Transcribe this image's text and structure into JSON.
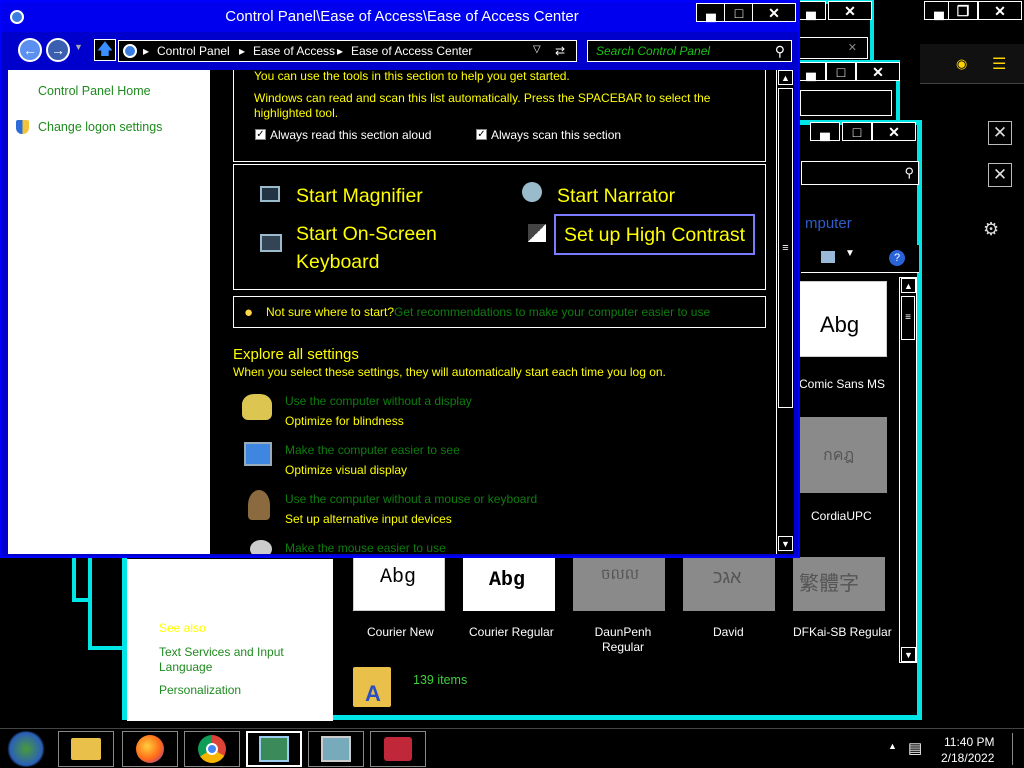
{
  "main_window": {
    "title": "Control Panel\\Ease of Access\\Ease of Access Center",
    "breadcrumbs": [
      "Control Panel",
      "Ease of Access",
      "Ease of Access Center"
    ],
    "search_placeholder": "Search Control Panel"
  },
  "left_pane": {
    "links": [
      "Control Panel Home",
      "Change logon settings"
    ]
  },
  "quick_access": {
    "intro": "You can use the tools in this section to help you get started.",
    "scan_text": "Windows can read and scan this list automatically.  Press the SPACEBAR to select the highlighted tool.",
    "checkbox_read": "Always read this section aloud",
    "checkbox_scan": "Always scan this section",
    "tools": [
      "Start Magnifier",
      "Start Narrator",
      "Start On-Screen Keyboard",
      "Set up High Contrast"
    ]
  },
  "tip": {
    "prefix": "Not sure where to start?",
    "link": "Get recommendations to make your computer easier to use"
  },
  "explore": {
    "heading": "Explore all settings",
    "description": "When you select these settings, they will automatically start each time you log on.",
    "items": [
      {
        "link": "Use the computer without a display",
        "sub": "Optimize for blindness"
      },
      {
        "link": "Make the computer easier to see",
        "sub": "Optimize visual display"
      },
      {
        "link": "Use the computer without a mouse or keyboard",
        "sub": "Set up alternative input devices"
      },
      {
        "link": "Make the mouse easier to use",
        "sub": ""
      }
    ]
  },
  "fonts_window": {
    "title_fragment": "mputer",
    "fonts": [
      {
        "name": "Comic Sans MS",
        "sample": "Abg"
      },
      {
        "name": "CordiaUPC",
        "sample": "กคฎ"
      },
      {
        "name": "Courier New",
        "sample": "Abg"
      },
      {
        "name": "Courier Regular",
        "sample": "Abg"
      },
      {
        "name": "DaunPenh Regular",
        "sample": "ចលល"
      },
      {
        "name": "David",
        "sample": "אגכ"
      },
      {
        "name": "DFKai-SB Regular",
        "sample": "繁體字"
      }
    ],
    "side_links": [
      "See also",
      "Text Services and Input Language",
      "Personalization"
    ],
    "item_count": "139 items"
  },
  "taskbar": {
    "time": "11:40 PM",
    "date": "2/18/2022"
  }
}
